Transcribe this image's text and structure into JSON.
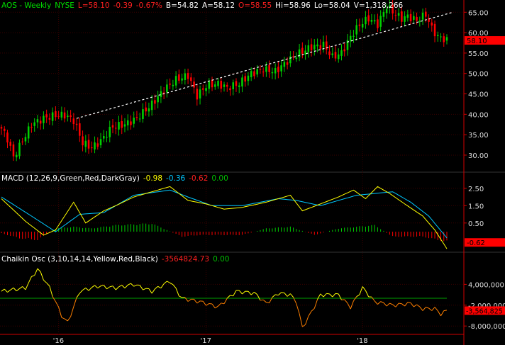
{
  "header": {
    "symbol": "AOS - Weekly",
    "exchange": "NYSE",
    "last": "L=58.10",
    "change": "-0.39",
    "change_pct": "-0.67%",
    "bid": "B=54.82",
    "ask": "A=58.12",
    "open": "O=58.55",
    "high": "Hi=58.96",
    "low": "Lo=58.04",
    "volume": "V=1,318,266"
  },
  "macd_header": {
    "label": "MACD (12,26,9,Green,Red,DarkGray)",
    "macd": "-0.98",
    "signal": "-0.36",
    "hist": "-0.62",
    "zero": "0.00"
  },
  "chaikin_header": {
    "label": "Chaikin Osc (3,10,14,14,Yellow,Red,Black)",
    "value": "-3564824.73",
    "zero": "0.00"
  },
  "price_axis": [
    "65.00",
    "60.00",
    "55.00",
    "50.00",
    "45.00",
    "40.00",
    "35.00",
    "30.00"
  ],
  "macd_axis": [
    "2.50",
    "1.50",
    "0.50"
  ],
  "chaikin_axis": [
    "4,000,000",
    "-2,000,000",
    "-8,000,000"
  ],
  "last_price_tag": "58.10",
  "macd_tag": "-0.62",
  "chaikin_tag": "-3,564,825",
  "x_axis": [
    "'16",
    "'17",
    "'18"
  ],
  "colors": {
    "up": "#00d000",
    "down": "#ff0000",
    "macd_line": "#ffff00",
    "signal_line": "#00c8ff",
    "chaikin_line": "#ffff00",
    "chaikin_zero": "#00a000",
    "grid": "#3a0000",
    "axis": "#d00000"
  },
  "chart_data": [
    {
      "type": "candlestick",
      "title": "AOS - Weekly",
      "x_ticks": [
        "'16",
        "'17",
        "'18"
      ],
      "ylim": [
        26,
        68
      ],
      "close_series_sampled": [
        [
          0,
          36.5
        ],
        [
          2,
          34.0
        ],
        [
          4,
          29.5
        ],
        [
          7,
          33.5
        ],
        [
          10,
          37.5
        ],
        [
          14,
          39.0
        ],
        [
          18,
          39.8
        ],
        [
          21,
          39.8
        ],
        [
          24,
          38.5
        ],
        [
          27,
          33.0
        ],
        [
          30,
          31.8
        ],
        [
          33,
          33.5
        ],
        [
          37,
          37.0
        ],
        [
          41,
          37.5
        ],
        [
          45,
          39.0
        ],
        [
          50,
          42.5
        ],
        [
          54,
          46.0
        ],
        [
          58,
          48.5
        ],
        [
          62,
          49.5
        ],
        [
          65,
          44.5
        ],
        [
          68,
          47.0
        ],
        [
          72,
          47.5
        ],
        [
          75,
          46.5
        ],
        [
          79,
          47.5
        ],
        [
          83,
          50.0
        ],
        [
          87,
          51.0
        ],
        [
          91,
          50.5
        ],
        [
          95,
          53.0
        ],
        [
          99,
          55.0
        ],
        [
          103,
          56.5
        ],
        [
          107,
          57.0
        ],
        [
          110,
          54.0
        ],
        [
          113,
          55.0
        ],
        [
          116,
          59.0
        ],
        [
          119,
          62.0
        ],
        [
          122,
          63.5
        ],
        [
          125,
          62.0
        ],
        [
          128,
          66.5
        ],
        [
          131,
          64.5
        ],
        [
          133,
          63.5
        ],
        [
          135,
          64.0
        ],
        [
          138,
          63.0
        ],
        [
          141,
          64.5
        ],
        [
          143,
          61.0
        ],
        [
          145,
          59.0
        ],
        [
          147,
          58.5
        ],
        [
          148,
          58.1
        ]
      ],
      "trendline": [
        [
          25,
          39.0
        ],
        [
          150,
          65.0
        ]
      ]
    },
    {
      "type": "line",
      "title": "MACD (12,26,9,Green,Red,DarkGray)",
      "series": [
        {
          "name": "MACD",
          "points": [
            [
              0,
              1.9
            ],
            [
              8,
              0.6
            ],
            [
              14,
              -0.2
            ],
            [
              18,
              0.1
            ],
            [
              24,
              1.7
            ],
            [
              28,
              0.5
            ],
            [
              34,
              1.2
            ],
            [
              38,
              1.5
            ],
            [
              44,
              2.0
            ],
            [
              56,
              2.6
            ],
            [
              62,
              1.8
            ],
            [
              68,
              1.6
            ],
            [
              74,
              1.3
            ],
            [
              80,
              1.4
            ],
            [
              88,
              1.7
            ],
            [
              96,
              2.1
            ],
            [
              100,
              1.2
            ],
            [
              106,
              1.6
            ],
            [
              112,
              2.0
            ],
            [
              117,
              2.4
            ],
            [
              121,
              1.9
            ],
            [
              125,
              2.6
            ],
            [
              129,
              2.2
            ],
            [
              134,
              1.6
            ],
            [
              140,
              0.9
            ],
            [
              144,
              0.1
            ],
            [
              148,
              -0.98
            ]
          ]
        },
        {
          "name": "Signal",
          "points": [
            [
              0,
              2.0
            ],
            [
              10,
              0.9
            ],
            [
              18,
              0.0
            ],
            [
              26,
              1.0
            ],
            [
              34,
              1.1
            ],
            [
              44,
              2.1
            ],
            [
              56,
              2.4
            ],
            [
              62,
              2.0
            ],
            [
              70,
              1.5
            ],
            [
              80,
              1.5
            ],
            [
              92,
              1.9
            ],
            [
              98,
              1.8
            ],
            [
              106,
              1.5
            ],
            [
              112,
              1.8
            ],
            [
              118,
              2.1
            ],
            [
              124,
              2.2
            ],
            [
              130,
              2.3
            ],
            [
              136,
              1.7
            ],
            [
              142,
              0.9
            ],
            [
              148,
              -0.36
            ]
          ]
        },
        {
          "name": "Histogram",
          "points": [
            [
              0,
              -0.1
            ],
            [
              6,
              -0.4
            ],
            [
              12,
              -0.5
            ],
            [
              18,
              0.2
            ],
            [
              24,
              0.3
            ],
            [
              30,
              0.2
            ],
            [
              38,
              0.4
            ],
            [
              50,
              0.5
            ],
            [
              60,
              -0.3
            ],
            [
              66,
              -0.2
            ],
            [
              80,
              -0.2
            ],
            [
              88,
              0.2
            ],
            [
              96,
              0.3
            ],
            [
              104,
              -0.2
            ],
            [
              112,
              0.2
            ],
            [
              124,
              0.4
            ],
            [
              130,
              -0.3
            ],
            [
              140,
              -0.3
            ],
            [
              148,
              -0.62
            ]
          ]
        }
      ],
      "ylim": [
        -1.1,
        2.9
      ]
    },
    {
      "type": "line",
      "title": "Chaikin Osc (3,10,14,14,Yellow,Red,Black)",
      "series": [
        {
          "name": "Chaikin Osc",
          "points": [
            [
              0,
              2000000
            ],
            [
              4,
              2500000
            ],
            [
              8,
              3000000
            ],
            [
              12,
              8500000
            ],
            [
              16,
              3000000
            ],
            [
              20,
              -5000000
            ],
            [
              22,
              -7000000
            ],
            [
              26,
              2000000
            ],
            [
              32,
              3500000
            ],
            [
              38,
              3000000
            ],
            [
              44,
              4000000
            ],
            [
              50,
              2000000
            ],
            [
              56,
              5000000
            ],
            [
              60,
              0
            ],
            [
              66,
              -1000000
            ],
            [
              72,
              -2500000
            ],
            [
              78,
              2000000
            ],
            [
              84,
              1500000
            ],
            [
              88,
              -1500000
            ],
            [
              92,
              1500000
            ],
            [
              96,
              1000000
            ],
            [
              98,
              -1000000
            ],
            [
              100,
              -8500000
            ],
            [
              103,
              -4000000
            ],
            [
              106,
              1000000
            ],
            [
              112,
              1000000
            ],
            [
              116,
              -2500000
            ],
            [
              120,
              3000000
            ],
            [
              124,
              -1000000
            ],
            [
              130,
              -2000000
            ],
            [
              136,
              -1500000
            ],
            [
              140,
              -3000000
            ],
            [
              144,
              -3000000
            ],
            [
              146,
              -4500000
            ],
            [
              148,
              -3564825
            ]
          ]
        }
      ],
      "ylim": [
        -10000000,
        10000000
      ]
    }
  ]
}
